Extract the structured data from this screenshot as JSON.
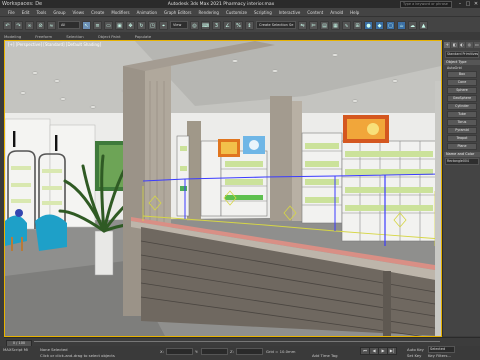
{
  "titlebar": {
    "workspace": "Workspaces: Design Default",
    "title": "Autodesk 3ds Max 2021  Pharmacy interior.max",
    "search_placeholder": "Type a keyword or phrase",
    "minimize": "–",
    "maximize": "□",
    "close": "✕"
  },
  "menubar": {
    "items": [
      "File",
      "Edit",
      "Tools",
      "Group",
      "Views",
      "Create",
      "Modifiers",
      "Animation",
      "Graph Editors",
      "Rendering",
      "Customize",
      "Scripting",
      "Interactive",
      "Content",
      "Arnold",
      "Help"
    ]
  },
  "toolbar": {
    "filter_value": "All",
    "view_value": "View",
    "selection_set_placeholder": "Create Selection Se"
  },
  "ribbon": {
    "items": [
      "Modeling",
      "Freeform",
      "Selection",
      "Object Paint",
      "Populate"
    ]
  },
  "viewport": {
    "label": "[+] [Perspective] [Standard] [Default Shading]"
  },
  "command_panel": {
    "tabs": [
      "+",
      "◧",
      "◐",
      "◎",
      "▭",
      "⚙"
    ],
    "category": "Standard Primitives",
    "rollout_object_type": "Object Type",
    "autogrid_label": "AutoGrid",
    "buttons": [
      "Box",
      "Cone",
      "Sphere",
      "GeoSphere",
      "Cylinder",
      "Tube",
      "Torus",
      "Pyramid",
      "Teapot",
      "Plane"
    ],
    "rollout_name": "Name and Color",
    "name_value": "Rectangle004"
  },
  "timeline": {
    "frame_label": "0 / 100"
  },
  "statusbar": {
    "script_label": "MAXScript Mi",
    "selection_text": "None Selected",
    "hint_text": "Click or click-and-drag to select objects",
    "x_label": "X:",
    "y_label": "Y:",
    "z_label": "Z:",
    "grid_text": "Grid = 10.0mm",
    "addtime_label": "Add Time Tag",
    "autokey_label": "Auto Key",
    "selected_value": "Selected",
    "setkey_label": "Set Key",
    "keyfilters_label": "Key Filters..."
  }
}
